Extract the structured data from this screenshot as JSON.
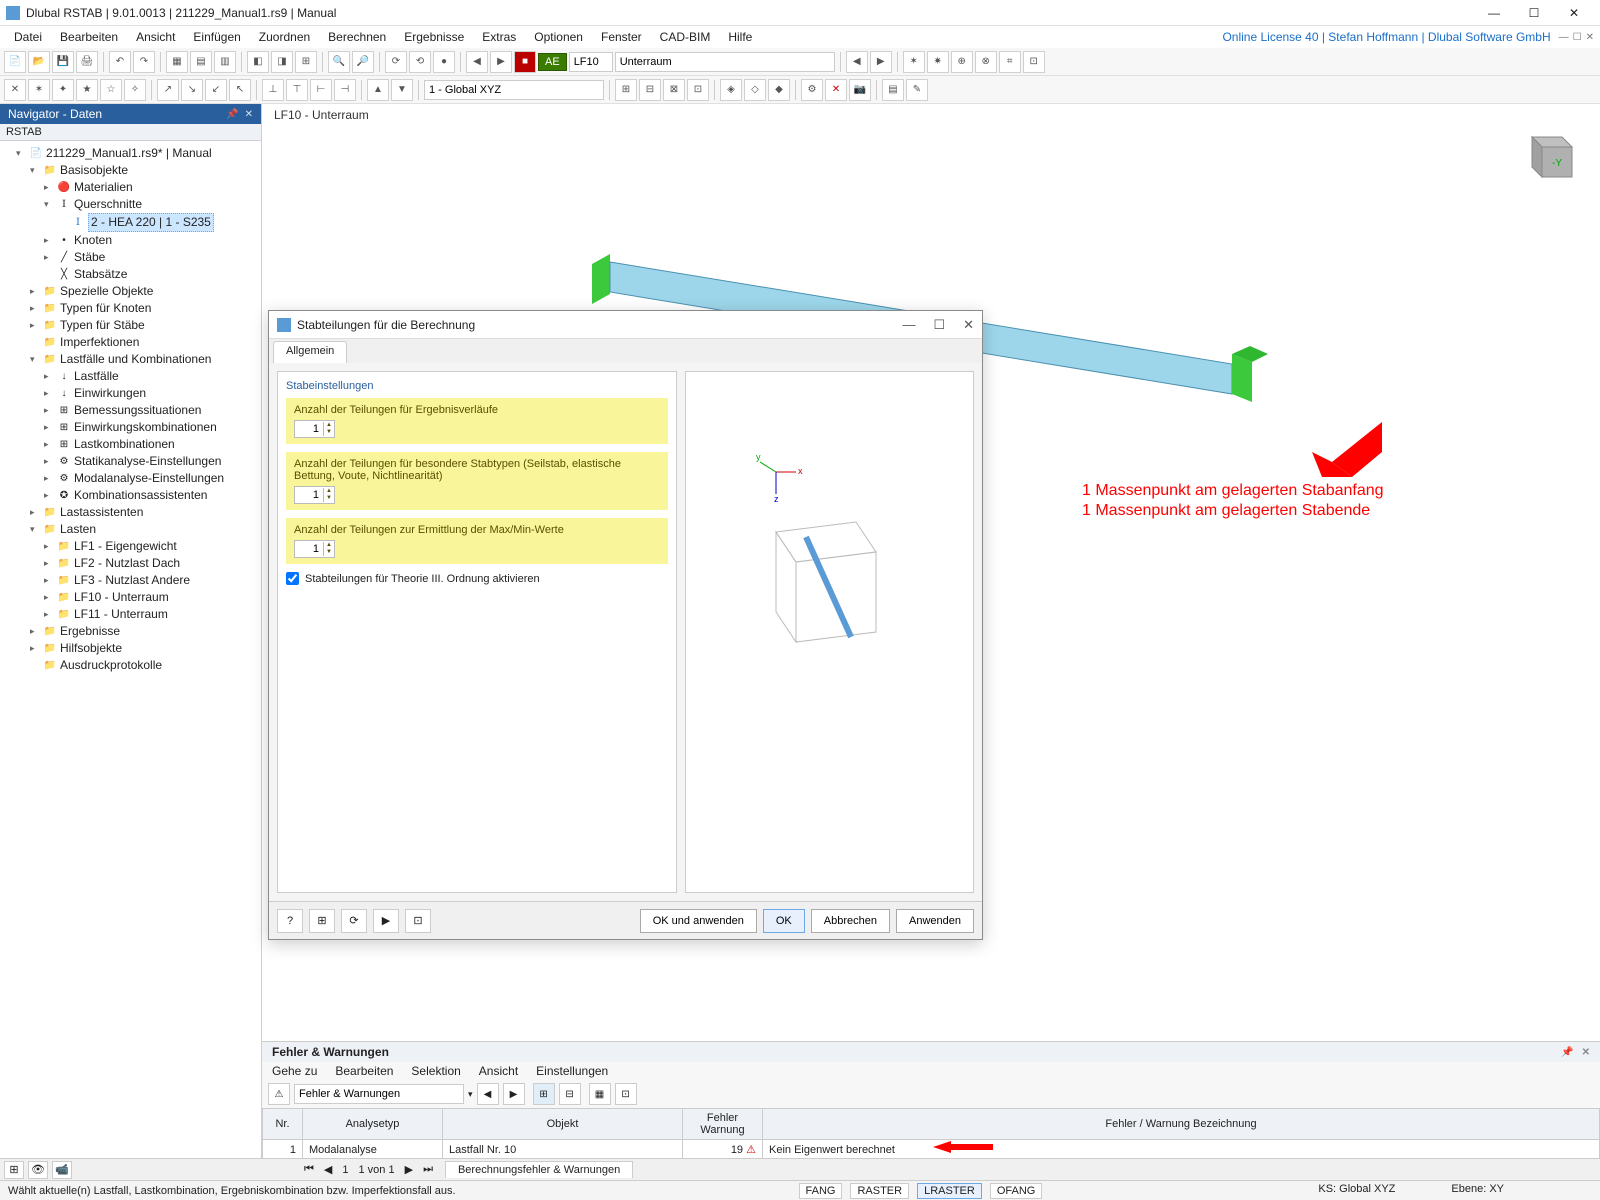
{
  "titlebar": {
    "text": "Dlubal RSTAB | 9.01.0013 | 211229_Manual1.rs9 | Manual"
  },
  "menus": [
    "Datei",
    "Bearbeiten",
    "Ansicht",
    "Einfügen",
    "Zuordnen",
    "Berechnen",
    "Ergebnisse",
    "Extras",
    "Optionen",
    "Fenster",
    "CAD-BIM",
    "Hilfe"
  ],
  "license": "Online License 40 | Stefan Hoffmann | Dlubal Software GmbH",
  "loadcase": {
    "tag": "AE",
    "num": "LF10",
    "name": "Unterraum"
  },
  "coord_sys": "1 - Global XYZ",
  "navigator": {
    "title": "Navigator - Daten",
    "root": "RSTAB",
    "file": "211229_Manual1.rs9* | Manual",
    "basis": "Basisobjekte",
    "materialien": "Materialien",
    "querschnitte": "Querschnitte",
    "selected_section": "2 - HEA 220 | 1 - S235",
    "knoten": "Knoten",
    "staebe": "Stäbe",
    "stabsaetze": "Stabsätze",
    "spezielle": "Spezielle Objekte",
    "typen_knoten": "Typen für Knoten",
    "typen_staebe": "Typen für Stäbe",
    "imperfektionen": "Imperfektionen",
    "lf_komb": "Lastfälle und Kombinationen",
    "lastfaelle": "Lastfälle",
    "einwirkungen": "Einwirkungen",
    "bemessung": "Bemessungssituationen",
    "einw_komb": "Einwirkungskombinationen",
    "lastkomb": "Lastkombinationen",
    "statik": "Statikanalyse-Einstellungen",
    "modal": "Modalanalyse-Einstellungen",
    "kombass": "Kombinationsassistenten",
    "lastass": "Lastassistenten",
    "lasten": "Lasten",
    "lf1": "LF1 - Eigengewicht",
    "lf2": "LF2 - Nutzlast Dach",
    "lf3": "LF3 - Nutzlast Andere",
    "lf10": "LF10 - Unterraum",
    "lf11": "LF11 - Unterraum",
    "ergebnisse": "Ergebnisse",
    "hilfsobjekte": "Hilfsobjekte",
    "ausdruck": "Ausdruckprotokolle"
  },
  "viewport": {
    "label": "LF10 - Unterraum"
  },
  "annotation1": "1 Massenpunkt am gelagerten Stabanfang",
  "annotation2": "1 Massenpunkt am gelagerten Stabende",
  "dialog": {
    "title": "Stabteilungen für die Berechnung",
    "tab": "Allgemein",
    "group": "Stabeinstellungen",
    "l1": "Anzahl der Teilungen für Ergebnisverläufe",
    "v1": "1",
    "l2": "Anzahl der Teilungen für besondere Stabtypen (Seilstab, elastische Bettung, Voute, Nichtlinearität)",
    "v2": "1",
    "l3": "Anzahl der Teilungen zur Ermittlung der Max/Min-Werte",
    "v3": "1",
    "check": "Stabteilungen für Theorie III. Ordnung aktivieren",
    "ok_apply": "OK und anwenden",
    "ok": "OK",
    "cancel": "Abbrechen",
    "apply": "Anwenden"
  },
  "errors": {
    "title": "Fehler & Warnungen",
    "menu": [
      "Gehe zu",
      "Bearbeiten",
      "Selektion",
      "Ansicht",
      "Einstellungen"
    ],
    "selector": "Fehler & Warnungen",
    "headers": [
      "Nr.",
      "Analysetyp",
      "Objekt",
      "Fehler Warnung",
      "Fehler / Warnung Bezeichnung"
    ],
    "row": {
      "nr": "1",
      "type": "Modalanalyse",
      "obj": "Lastfall Nr. 10",
      "fw": "19",
      "desc": "Kein Eigenwert berechnet"
    }
  },
  "pager": {
    "pos": "1",
    "of": "1 von 1",
    "tab": "Berechnungsfehler & Warnungen"
  },
  "status": {
    "help": "Wählt aktuelle(n) Lastfall, Lastkombination, Ergebniskombination bzw. Imperfektionsfall aus.",
    "toggles": [
      "FANG",
      "RASTER",
      "LRASTER",
      "OFANG"
    ],
    "ks": "KS: Global XYZ",
    "ebene": "Ebene: XY"
  }
}
